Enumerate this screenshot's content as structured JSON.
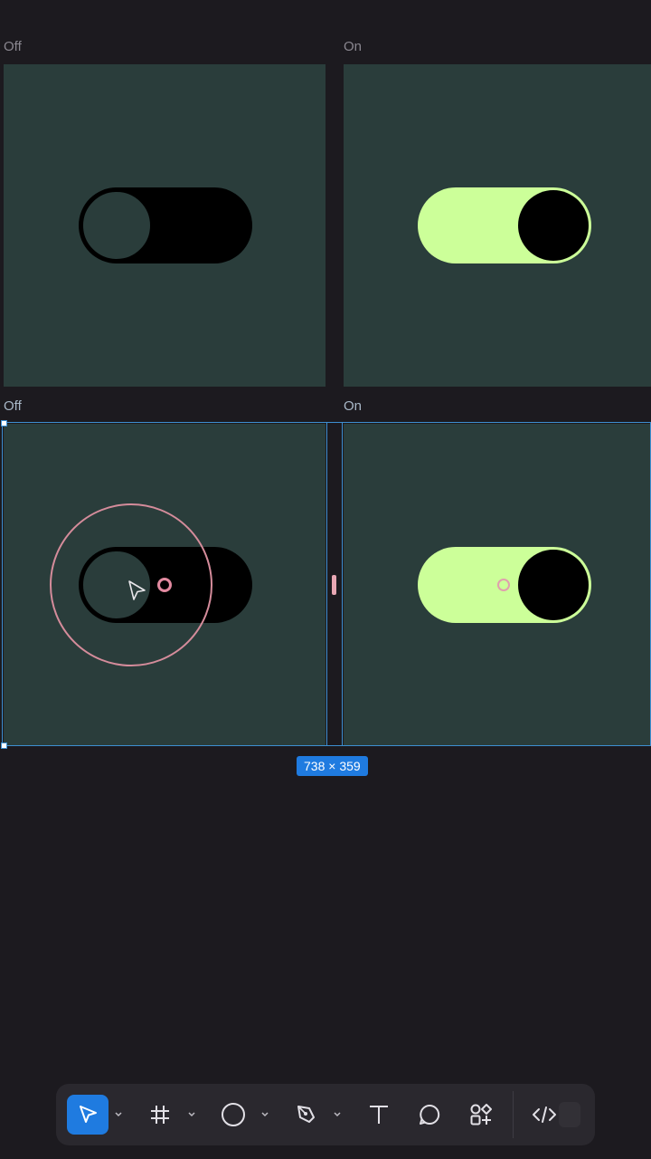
{
  "frames": [
    {
      "label": "Off",
      "state": "off"
    },
    {
      "label": "On",
      "state": "on"
    },
    {
      "label": "Off",
      "state": "off"
    },
    {
      "label": "On",
      "state": "on"
    }
  ],
  "selection": {
    "size_label": "738 × 359"
  },
  "colors": {
    "canvas_bg": "#1c1a1f",
    "frame_bg": "#2a3d3b",
    "toggle_on": "#ccff99",
    "toggle_off": "#000000",
    "selection": "#3d8fd1",
    "badge": "#1f7be0"
  },
  "toolbar": {
    "tools": [
      {
        "name": "move-tool",
        "icon": "cursor-arrow-icon",
        "active": true
      },
      {
        "name": "frame-tool",
        "icon": "hash-frame-icon",
        "active": false
      },
      {
        "name": "shape-tool",
        "icon": "circle-icon",
        "active": false
      },
      {
        "name": "pen-tool",
        "icon": "pen-nib-icon",
        "active": false
      },
      {
        "name": "text-tool",
        "icon": "text-t-icon",
        "active": false
      },
      {
        "name": "comment-tool",
        "icon": "speech-bubble-icon",
        "active": false
      },
      {
        "name": "components-tool",
        "icon": "components-grid-icon",
        "active": false
      },
      {
        "name": "dev-mode-toggle",
        "icon": "code-brackets-icon",
        "active": false
      }
    ]
  }
}
